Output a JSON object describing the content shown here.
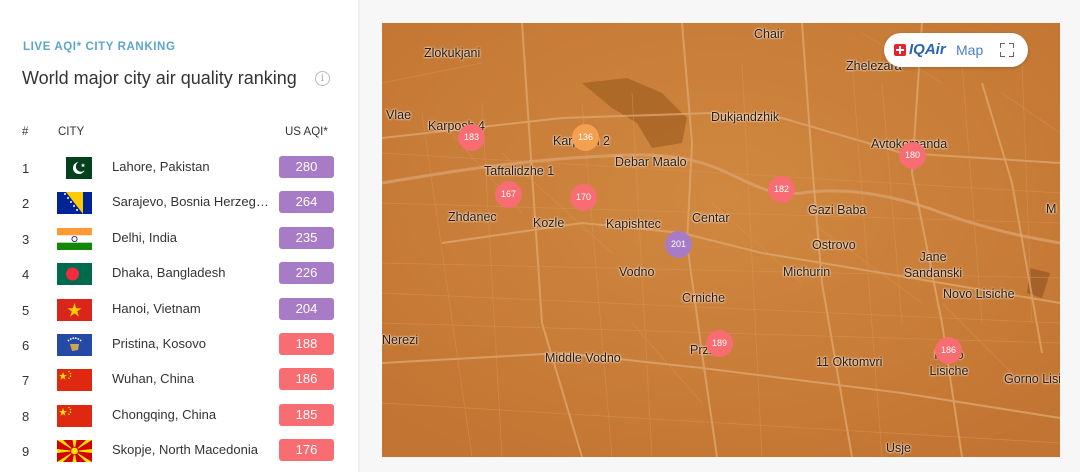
{
  "header": {
    "eyebrow": "LIVE AQI* CITY RANKING",
    "title": "World major city air quality ranking",
    "info_glyph": "i"
  },
  "table": {
    "columns": [
      "#",
      "CITY",
      "US AQI*"
    ],
    "rows": [
      {
        "rank": "1",
        "city": "Lahore, Pakistan",
        "aqi": "280",
        "flag": "pakistan-flag",
        "color": "#a87bc6"
      },
      {
        "rank": "2",
        "city": "Sarajevo, Bosnia Herzegovina",
        "aqi": "264",
        "flag": "bosnia-herzegovina-flag",
        "color": "#a87bc6"
      },
      {
        "rank": "3",
        "city": "Delhi, India",
        "aqi": "235",
        "flag": "india-flag",
        "color": "#a87bc6"
      },
      {
        "rank": "4",
        "city": "Dhaka, Bangladesh",
        "aqi": "226",
        "flag": "bangladesh-flag",
        "color": "#a87bc6"
      },
      {
        "rank": "5",
        "city": "Hanoi, Vietnam",
        "aqi": "204",
        "flag": "vietnam-flag",
        "color": "#a87bc6"
      },
      {
        "rank": "6",
        "city": "Pristina, Kosovo",
        "aqi": "188",
        "flag": "kosovo-flag",
        "color": "#f76d72"
      },
      {
        "rank": "7",
        "city": "Wuhan, China",
        "aqi": "186",
        "flag": "china-flag",
        "color": "#f76d72"
      },
      {
        "rank": "8",
        "city": "Chongqing, China",
        "aqi": "185",
        "flag": "china-flag",
        "color": "#f76d72"
      },
      {
        "rank": "9",
        "city": "Skopje, North Macedonia",
        "aqi": "176",
        "flag": "north-macedonia-flag",
        "color": "#f76d72"
      }
    ]
  },
  "map": {
    "brand": "IQAir",
    "brand_suffix": "Map",
    "places": [
      "Chair",
      "Zlokukjani",
      "Zhelezara",
      "Vlae",
      "Karposh 4",
      "Karposh 2",
      "Dukjandzhik",
      "Debar Maalo",
      "Avtokomanda",
      "Taftalidzhe 1",
      "Zhdanec",
      "Kozle",
      "Kapishtec",
      "Centar",
      "Gazi Baba",
      "Ostrovo",
      "Vodno",
      "Michurin",
      "Jane Sandanski",
      "Crniche",
      "Novo Lisiche",
      "Nerezi",
      "Middle Vodno",
      "Przino",
      "11 Oktomvri",
      "Novo Lisiche",
      "Gorno Lisiche",
      "Usje",
      "M"
    ],
    "markers": [
      {
        "value": "183",
        "color": "#f76d72"
      },
      {
        "value": "136",
        "color": "#f5a050"
      },
      {
        "value": "167",
        "color": "#f76d72"
      },
      {
        "value": "170",
        "color": "#f76d72"
      },
      {
        "value": "182",
        "color": "#f76d72"
      },
      {
        "value": "180",
        "color": "#f76d72"
      },
      {
        "value": "201",
        "color": "#a87bc6"
      },
      {
        "value": "189",
        "color": "#f76d72"
      },
      {
        "value": "186",
        "color": "#f76d72"
      }
    ]
  }
}
